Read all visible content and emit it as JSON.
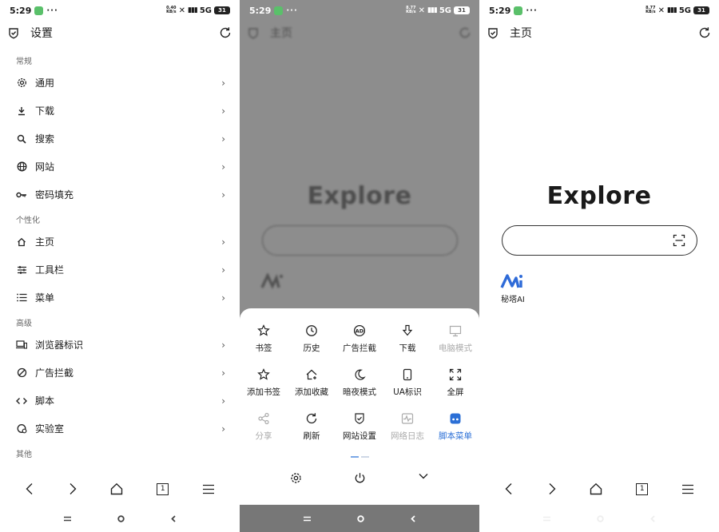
{
  "status_bar": {
    "time": "5:29",
    "dots": "···",
    "network": "5G",
    "battery": "31"
  },
  "status_speeds": [
    "0.40\nKB/s",
    "8.77\nKB/s",
    "8.77\nKB/s"
  ],
  "settings": {
    "title": "设置",
    "sections": [
      {
        "header": "常规",
        "items": [
          {
            "label": "通用",
            "icon": "gear-icon"
          },
          {
            "label": "下载",
            "icon": "download-icon"
          },
          {
            "label": "搜索",
            "icon": "search-icon"
          },
          {
            "label": "网站",
            "icon": "globe-icon"
          },
          {
            "label": "密码填充",
            "icon": "key-icon"
          }
        ]
      },
      {
        "header": "个性化",
        "items": [
          {
            "label": "主页",
            "icon": "home-icon"
          },
          {
            "label": "工具栏",
            "icon": "sliders-icon"
          },
          {
            "label": "菜单",
            "icon": "list-icon"
          }
        ]
      },
      {
        "header": "高级",
        "items": [
          {
            "label": "浏览器标识",
            "icon": "devices-icon"
          },
          {
            "label": "广告拦截",
            "icon": "block-icon"
          },
          {
            "label": "脚本",
            "icon": "code-icon"
          },
          {
            "label": "实验室",
            "icon": "lab-icon"
          }
        ]
      },
      {
        "header": "其他",
        "items": []
      }
    ]
  },
  "home": {
    "title": "主页",
    "explore": "Explore",
    "search_placeholder": "",
    "shortcut_label": "秘塔AI"
  },
  "menu": {
    "items": [
      {
        "label": "书签",
        "icon": "star-icon",
        "state": "normal"
      },
      {
        "label": "历史",
        "icon": "clock-icon",
        "state": "normal"
      },
      {
        "label": "广告拦截",
        "icon": "adblock-icon",
        "state": "normal"
      },
      {
        "label": "下载",
        "icon": "download-arrow-icon",
        "state": "normal"
      },
      {
        "label": "电脑模式",
        "icon": "monitor-icon",
        "state": "disabled"
      },
      {
        "label": "添加书签",
        "icon": "star-plus-icon",
        "state": "normal"
      },
      {
        "label": "添加收藏",
        "icon": "home-plus-icon",
        "state": "normal"
      },
      {
        "label": "暗夜模式",
        "icon": "moon-icon",
        "state": "normal"
      },
      {
        "label": "UA标识",
        "icon": "phone-icon",
        "state": "normal"
      },
      {
        "label": "全屏",
        "icon": "fullscreen-icon",
        "state": "normal"
      },
      {
        "label": "分享",
        "icon": "share-icon",
        "state": "disabled"
      },
      {
        "label": "刷新",
        "icon": "refresh-icon",
        "state": "normal"
      },
      {
        "label": "网站设置",
        "icon": "shield-check-icon",
        "state": "normal"
      },
      {
        "label": "网络日志",
        "icon": "pulse-icon",
        "state": "disabled"
      },
      {
        "label": "脚本菜单",
        "icon": "script-menu-icon",
        "state": "active"
      }
    ]
  },
  "bottom_nav_tab_count": "1",
  "colors": {
    "accent": "#2b6fd6",
    "text": "#1a1a1a",
    "disabled": "#aaaaaa",
    "dim": "#8d8d8d",
    "logo": "#2f6bd8"
  }
}
